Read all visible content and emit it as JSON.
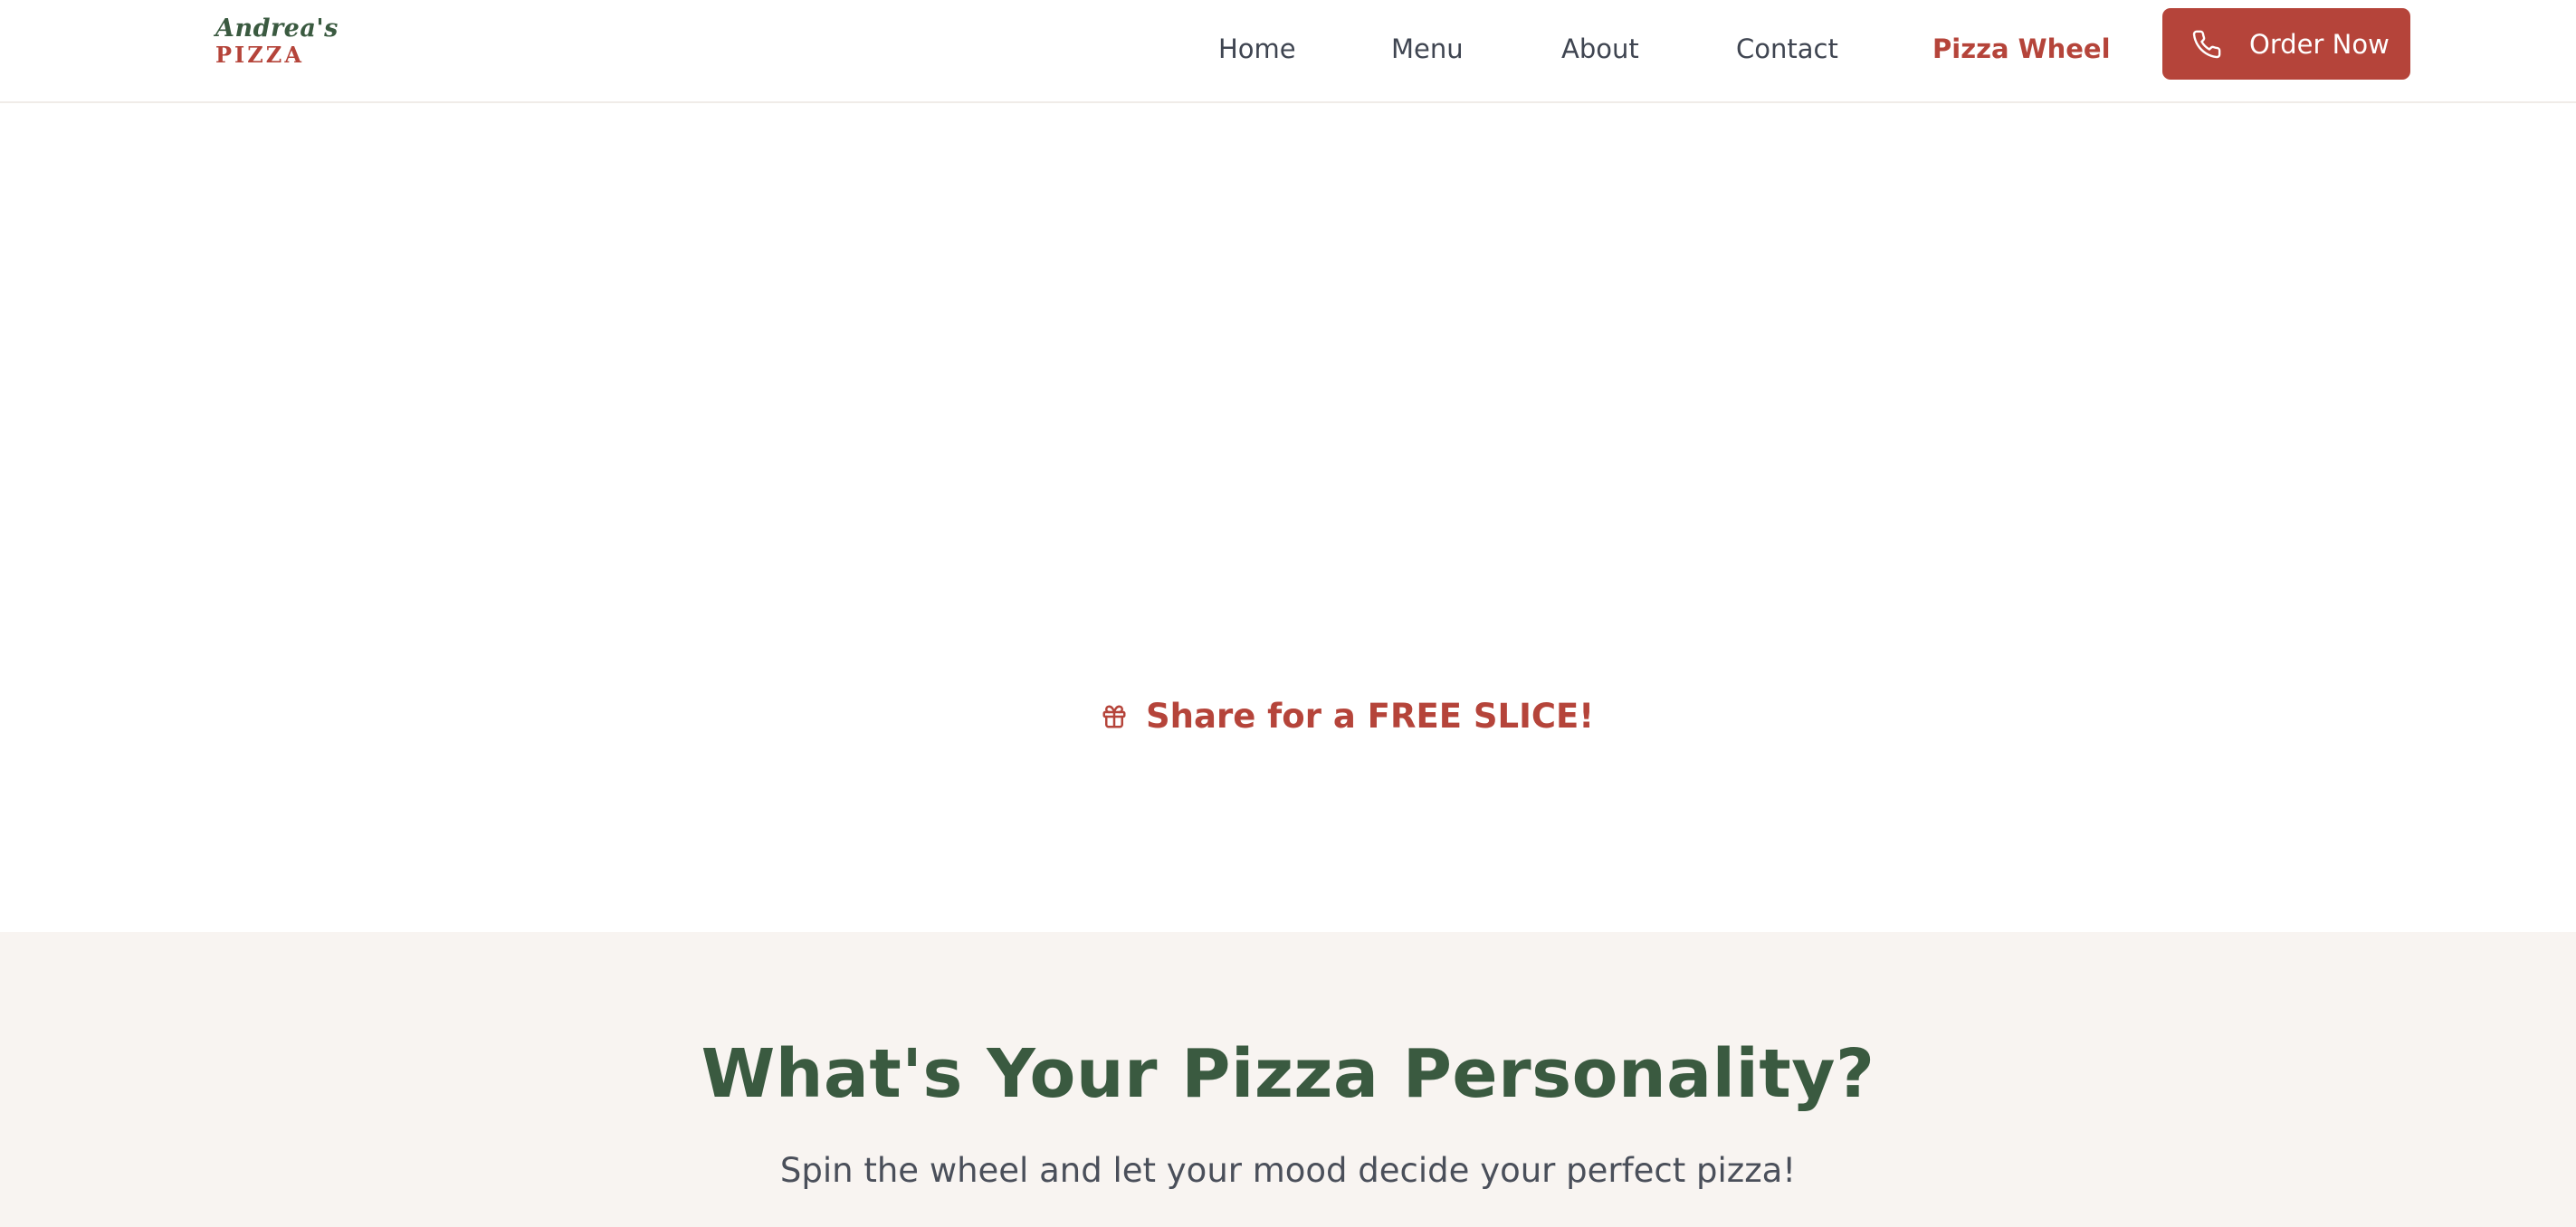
{
  "logo": {
    "line1": "Andrea's",
    "line2": "PIZZA"
  },
  "nav": {
    "items": [
      {
        "label": "Home",
        "active": false
      },
      {
        "label": "Menu",
        "active": false
      },
      {
        "label": "About",
        "active": false
      },
      {
        "label": "Contact",
        "active": false
      },
      {
        "label": "Pizza Wheel",
        "active": true
      }
    ],
    "cta": {
      "label": "Order Now",
      "icon": "phone-icon"
    }
  },
  "share": {
    "icon": "gift-icon",
    "label": "Share for a FREE SLICE!"
  },
  "personality": {
    "title": "What's Your Pizza Personality?",
    "subtitle": "Spin the wheel and let your mood decide your perfect pizza!"
  },
  "colors": {
    "brand_green": "#3a5a40",
    "brand_red": "#b5443a",
    "section_bg": "#f8f4f1",
    "nav_text": "#3f4551"
  }
}
